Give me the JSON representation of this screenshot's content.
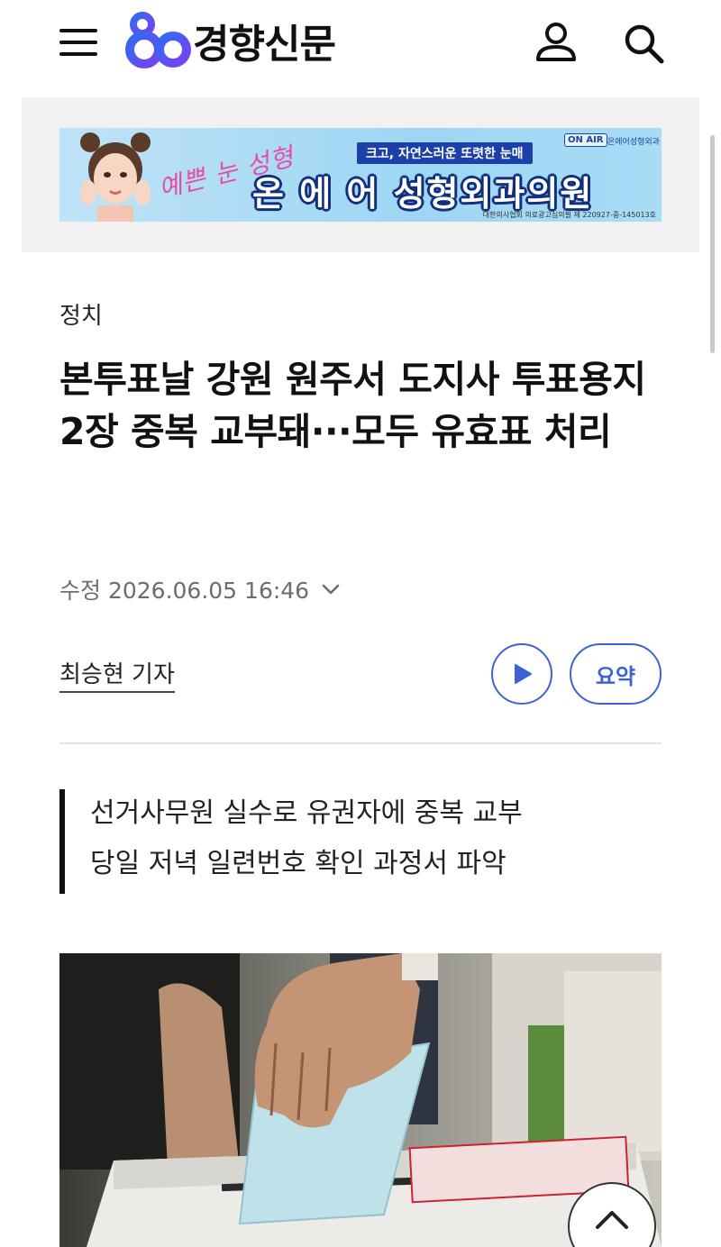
{
  "header": {
    "logo_text": "경향신문",
    "logo_icon": "khan-logo-icon",
    "menu_icon": "hamburger-menu-icon",
    "user_icon": "user-icon",
    "search_icon": "search-icon"
  },
  "ad": {
    "script_text": "예쁜 눈 성형",
    "tagline": "크고, 자연스러운 또렷한 눈매",
    "clinic_name": "온 에 어 성형외과의원",
    "badge": "ON AIR",
    "badge_sub": "온에어성형외과",
    "fine_print": "대한의사협회 의료광고심의필 제 220927-중-145013호"
  },
  "article": {
    "category": "정치",
    "headline": "본투표날 강원 원주서 도지사 투표용지 2장 중복 교부돼···모두 유효표 처리",
    "dateline": "수정 2026.06.05 16:46",
    "reporter": "최승현 기자",
    "summary_label": "요약",
    "subheadlines": [
      "선거사무원 실수로 유권자에 중복 교부",
      "당일 저녁 일련번호 확인 과정서 파악"
    ]
  },
  "colors": {
    "accent": "#3b63d6",
    "logo_blue": "#2f6df0",
    "logo_purple": "#7a3ff2",
    "text": "#111111",
    "muted": "#6d6d6d"
  }
}
